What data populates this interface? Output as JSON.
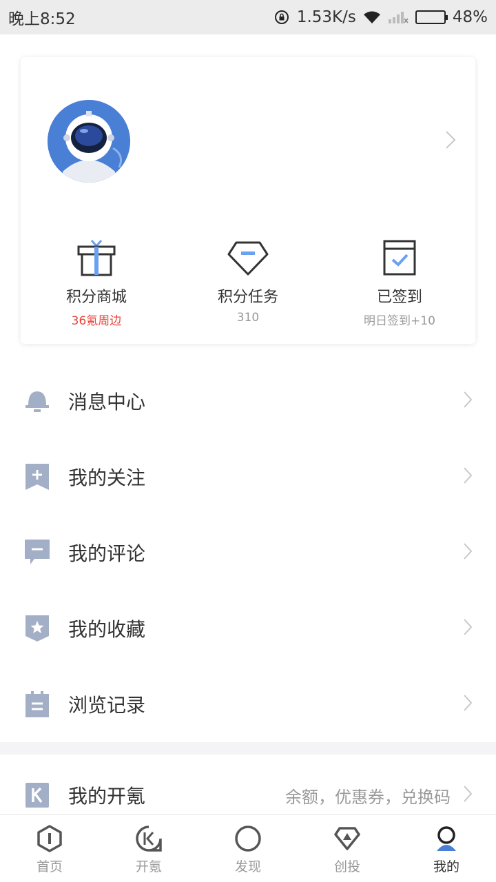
{
  "status_bar": {
    "time": "晚上8:52",
    "network_speed": "1.53K/s",
    "battery": "48%",
    "battery_level": 0.48,
    "icons": [
      "rotation-lock-icon",
      "wifi-icon",
      "signal-icon",
      "battery-icon"
    ]
  },
  "profile": {
    "avatar": "astronaut-avatar",
    "stats": [
      {
        "label": "积分商城",
        "sub": "36氪周边",
        "icon": "gift-icon"
      },
      {
        "label": "积分任务",
        "sub": "310",
        "icon": "diamond-icon"
      },
      {
        "label": "已签到",
        "sub": "明日签到+10",
        "icon": "calendar-check-icon"
      }
    ]
  },
  "menu": [
    {
      "label": "消息中心",
      "icon": "bell-icon"
    },
    {
      "label": "我的关注",
      "icon": "bookmark-plus-icon"
    },
    {
      "label": "我的评论",
      "icon": "comment-icon"
    },
    {
      "label": "我的收藏",
      "icon": "star-bookmark-icon"
    },
    {
      "label": "浏览记录",
      "icon": "history-icon"
    }
  ],
  "wallet": {
    "label": "我的开氪",
    "extra": "余额，优惠券，兑换码",
    "icon": "k-icon"
  },
  "tabs": [
    {
      "label": "首页",
      "icon": "home-icon"
    },
    {
      "label": "开氪",
      "icon": "kaike-icon"
    },
    {
      "label": "发现",
      "icon": "compass-icon"
    },
    {
      "label": "创投",
      "icon": "venture-icon"
    },
    {
      "label": "我的",
      "icon": "profile-icon"
    }
  ],
  "colors": {
    "accent_blue": "#4a7fd6",
    "menu_icon": "#a3afc6",
    "red": "#e8453c",
    "muted": "#999999"
  }
}
